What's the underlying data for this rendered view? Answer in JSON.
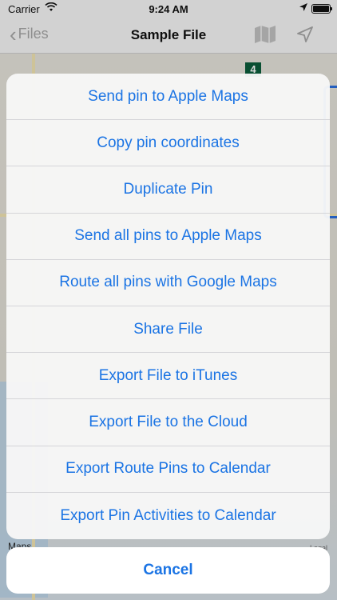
{
  "status_bar": {
    "carrier": "Carrier",
    "time": "9:24 AM"
  },
  "nav": {
    "back_label": "Files",
    "title": "Sample File"
  },
  "map": {
    "marker_label": "4",
    "logo": "Maps",
    "legal": "Legal"
  },
  "actions": [
    "Send pin to Apple Maps",
    "Copy pin coordinates",
    "Duplicate Pin",
    "Send all pins to Apple Maps",
    "Route all pins with Google Maps",
    "Share File",
    "Export File to iTunes",
    "Export File to the Cloud",
    "Export Route Pins to Calendar",
    "Export Pin Activities to Calendar"
  ],
  "cancel_label": "Cancel",
  "colors": {
    "tint": "#1b74e4",
    "nav_bg": "#f7f7f7",
    "sheet_bg": "#f7f7f7"
  }
}
